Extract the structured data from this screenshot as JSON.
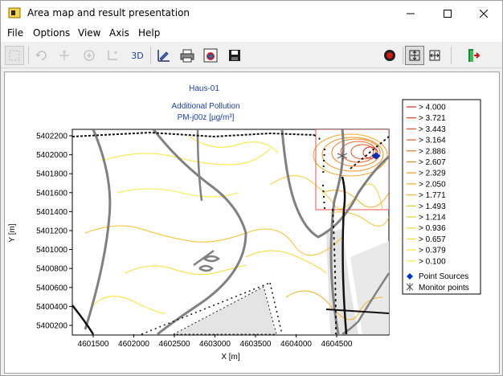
{
  "window": {
    "title": "Area map and result presentation",
    "icon": "folder-app-icon",
    "controls": [
      "minimize-icon",
      "maximize-icon",
      "close-icon"
    ]
  },
  "menu": [
    "File",
    "Options",
    "View",
    "Axis",
    "Help"
  ],
  "toolbar": {
    "left_buttons": [
      "select-icon",
      "rotate-icon",
      "rotate-disabled-icon",
      "zoom-icon",
      "axis-icon"
    ],
    "three_d_label": "3D",
    "mid_buttons": [
      "draw-settings-icon",
      "print-icon",
      "color-map-icon",
      "save-icon"
    ],
    "right_buttons": [
      "record-icon",
      "fit-view-icon",
      "pan-icon",
      "exit-icon"
    ]
  },
  "map": {
    "title": "Haus-01",
    "subtitle1": "Additional Pollution",
    "subtitle2": "PM-j00z [µg/m³]",
    "xlabel": "X [m]",
    "ylabel": "Y [m]",
    "xticks": [
      "4601500",
      "4602000",
      "4602500",
      "4603000",
      "4603500",
      "4604000",
      "4604500"
    ],
    "yticks": [
      "5402200",
      "5402000",
      "5401800",
      "5401600",
      "5401400",
      "5401200",
      "5401000",
      "5400800",
      "5400600",
      "5400400",
      "5400200"
    ]
  },
  "legend": {
    "items": [
      {
        "label": "> 4.000",
        "color": "#e8281e"
      },
      {
        "label": "> 3.721",
        "color": "#ea3a1e"
      },
      {
        "label": "> 3.443",
        "color": "#ec4c1f"
      },
      {
        "label": "> 3.164",
        "color": "#ee5e20"
      },
      {
        "label": "> 2.886",
        "color": "#f07021"
      },
      {
        "label": "> 2.607",
        "color": "#f28222"
      },
      {
        "label": "> 2.329",
        "color": "#f49423"
      },
      {
        "label": "> 2.050",
        "color": "#f6a624"
      },
      {
        "label": "> 1.771",
        "color": "#f7b426"
      },
      {
        "label": "> 1.493",
        "color": "#f8c028"
      },
      {
        "label": "> 1.214",
        "color": "#f9cc2a"
      },
      {
        "label": "> 0.936",
        "color": "#fad62c"
      },
      {
        "label": "> 0.657",
        "color": "#fbdf30"
      },
      {
        "label": "> 0.379",
        "color": "#fce636"
      },
      {
        "label": "> 0.100",
        "color": "#fdec3c"
      }
    ],
    "point_sources": "Point Sources",
    "monitor_points": "Monitor points",
    "point_source_color": "#0033cc",
    "monitor_color": "#555555"
  }
}
